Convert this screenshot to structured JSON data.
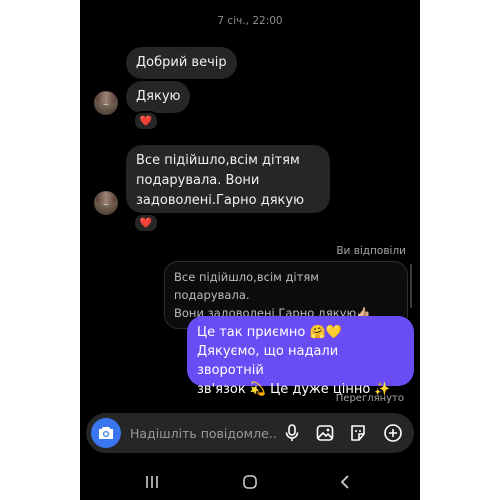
{
  "chat": {
    "timestamp": "7 січ., 22:00",
    "incoming": [
      {
        "text": "Добрий вечір"
      },
      {
        "text": "Дякую",
        "reaction": "❤️"
      },
      {
        "lines": [
          "Все підійшло,всім дітям",
          "подарувала. Вони",
          "задоволені.Гарно дякую👍🏼"
        ],
        "reaction": "❤️"
      }
    ],
    "replied_label": "Ви відповіли",
    "quoted_lines": [
      "Все підійшло,всім дітям подарувала.",
      "Вони задоволені.Гарно дякую👍🏼"
    ],
    "outgoing_lines": [
      "Це так приємно 🤗💛",
      "Дякуємо, що надали зворотній",
      "зв'язок 💫 Це дуже цінно ✨"
    ],
    "seen_label": "Переглянуто"
  },
  "composer": {
    "placeholder": "Надішліть повідомле...",
    "icons": [
      "camera-icon",
      "microphone-icon",
      "gallery-icon",
      "sticker-icon",
      "plus-icon"
    ]
  },
  "navbar": {
    "icons": [
      "recent-apps-icon",
      "home-icon",
      "back-icon"
    ]
  },
  "colors": {
    "outgoing_bubble": "#6a4cf5",
    "incoming_bubble": "#262626",
    "camera_button": "#3a76f0",
    "background": "#000000"
  }
}
